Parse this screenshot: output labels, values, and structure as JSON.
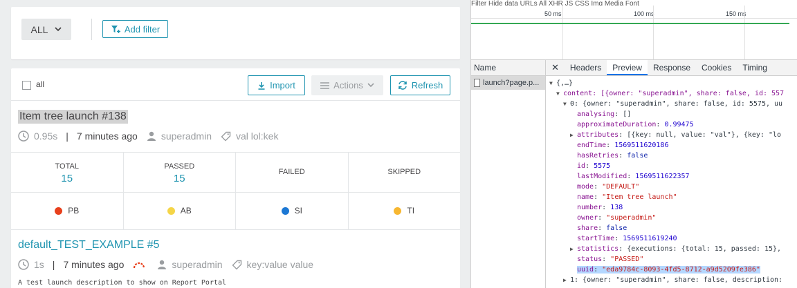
{
  "filter_bar": {
    "select_value": "ALL",
    "add_filter_label": "Add filter"
  },
  "toolbar": {
    "select_all_label": "all",
    "import_label": "Import",
    "actions_label": "Actions",
    "refresh_label": "Refresh"
  },
  "launch1": {
    "title": "Item tree launch #138",
    "duration": "0.95s",
    "started": "7 minutes ago",
    "owner": "superadmin",
    "attribute": "val lol:kek",
    "stats": [
      {
        "label": "TOTAL",
        "value": "15"
      },
      {
        "label": "PASSED",
        "value": "15"
      },
      {
        "label": "FAILED",
        "value": ""
      },
      {
        "label": "SKIPPED",
        "value": ""
      }
    ],
    "defects": [
      {
        "label": "PB",
        "color": "#e8401c"
      },
      {
        "label": "AB",
        "color": "#f5d547"
      },
      {
        "label": "SI",
        "color": "#1c78d4"
      },
      {
        "label": "TI",
        "color": "#f7b731"
      }
    ]
  },
  "launch2": {
    "title": "default_TEST_EXAMPLE #5",
    "duration": "1s",
    "started": "7 minutes ago",
    "owner": "superadmin",
    "attribute": "key:value value",
    "description": "A test launch description to show on Report Portal"
  },
  "devtools": {
    "top_strip": "Filter          Hide data URLs  All   XHR  JS  CSS  Img  Media  Font",
    "ticks": [
      "50 ms",
      "100 ms",
      "150 ms"
    ],
    "name_header": "Name",
    "request_name": "launch?page.p...",
    "tabs": [
      "Headers",
      "Preview",
      "Response",
      "Cookies",
      "Timing"
    ],
    "active_tab": "Preview",
    "preview": {
      "root": "{,…}",
      "content_line": "content: [{owner: \"superadmin\", share: false, id: 557",
      "item0_line": "0: {owner: \"superadmin\", share: false, id: 5575, uu",
      "fields": [
        {
          "key": "analysing",
          "value": "[]",
          "type": "p",
          "expand": false
        },
        {
          "key": "approximateDuration",
          "value": "0.99475",
          "type": "n",
          "expand": false
        },
        {
          "key": "attributes",
          "value": "[{key: null, value: \"val\"}, {key: \"lo",
          "type": "p",
          "expand": true
        },
        {
          "key": "endTime",
          "value": "1569511620186",
          "type": "n",
          "expand": false
        },
        {
          "key": "hasRetries",
          "value": "false",
          "type": "b",
          "expand": false
        },
        {
          "key": "id",
          "value": "5575",
          "type": "n",
          "expand": false
        },
        {
          "key": "lastModified",
          "value": "1569511622357",
          "type": "n",
          "expand": false
        },
        {
          "key": "mode",
          "value": "\"DEFAULT\"",
          "type": "s",
          "expand": false
        },
        {
          "key": "name",
          "value": "\"Item tree launch\"",
          "type": "s",
          "expand": false
        },
        {
          "key": "number",
          "value": "138",
          "type": "n",
          "expand": false
        },
        {
          "key": "owner",
          "value": "\"superadmin\"",
          "type": "s",
          "expand": false
        },
        {
          "key": "share",
          "value": "false",
          "type": "b",
          "expand": false
        },
        {
          "key": "startTime",
          "value": "1569511619240",
          "type": "n",
          "expand": false
        },
        {
          "key": "statistics",
          "value": "{executions: {total: 15, passed: 15},",
          "type": "p",
          "expand": true
        },
        {
          "key": "status",
          "value": "\"PASSED\"",
          "type": "s",
          "expand": false
        },
        {
          "key": "uuid",
          "value": "\"eda9784c-8093-4fd5-8712-a9d5209fe386\"",
          "type": "s",
          "expand": false,
          "highlight": true
        }
      ],
      "item1_line": "1: {owner: \"superadmin\", share: false, description:"
    }
  }
}
